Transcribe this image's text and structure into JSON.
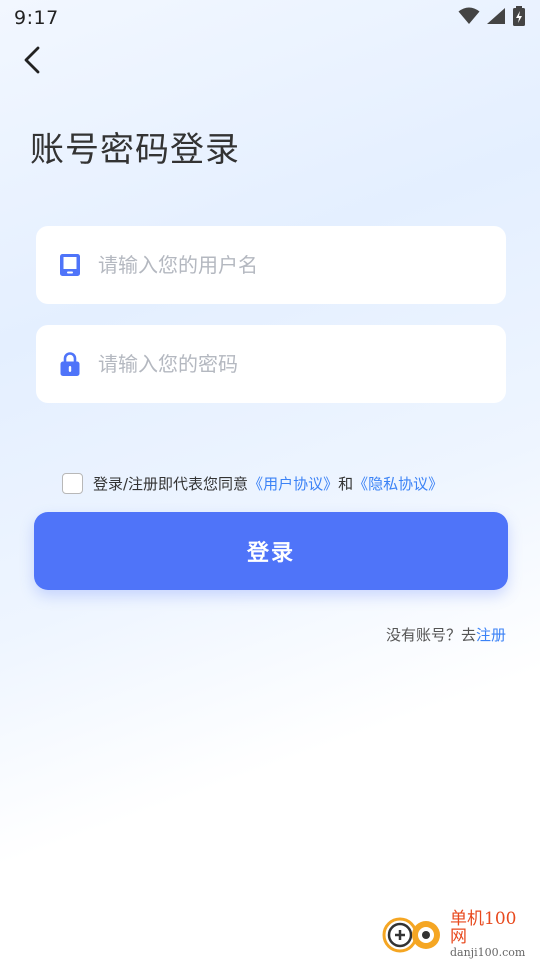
{
  "status_bar": {
    "time": "9:17",
    "icons": [
      "wifi-icon",
      "signal-icon",
      "battery-charging-icon"
    ]
  },
  "header": {
    "back_icon": "chevron-left-icon",
    "title": "账号密码登录"
  },
  "form": {
    "username": {
      "icon": "phone-icon",
      "placeholder": "请输入您的用户名",
      "value": ""
    },
    "password": {
      "icon": "lock-icon",
      "placeholder": "请输入您的密码",
      "value": ""
    }
  },
  "agreement": {
    "checked": false,
    "prefix": "登录/注册即代表您同意",
    "user_agreement": "《用户协议》",
    "and": "和",
    "privacy_policy": "《隐私协议》"
  },
  "login_button": {
    "label": "登录"
  },
  "register": {
    "prompt": "没有账号？去",
    "link": "注册"
  },
  "watermark": {
    "name": "单机100网",
    "url": "danji100.com"
  },
  "colors": {
    "accent": "#4f74f9",
    "link": "#3b82f6",
    "icon": "#4f74f9",
    "watermark": "#e8491d"
  }
}
